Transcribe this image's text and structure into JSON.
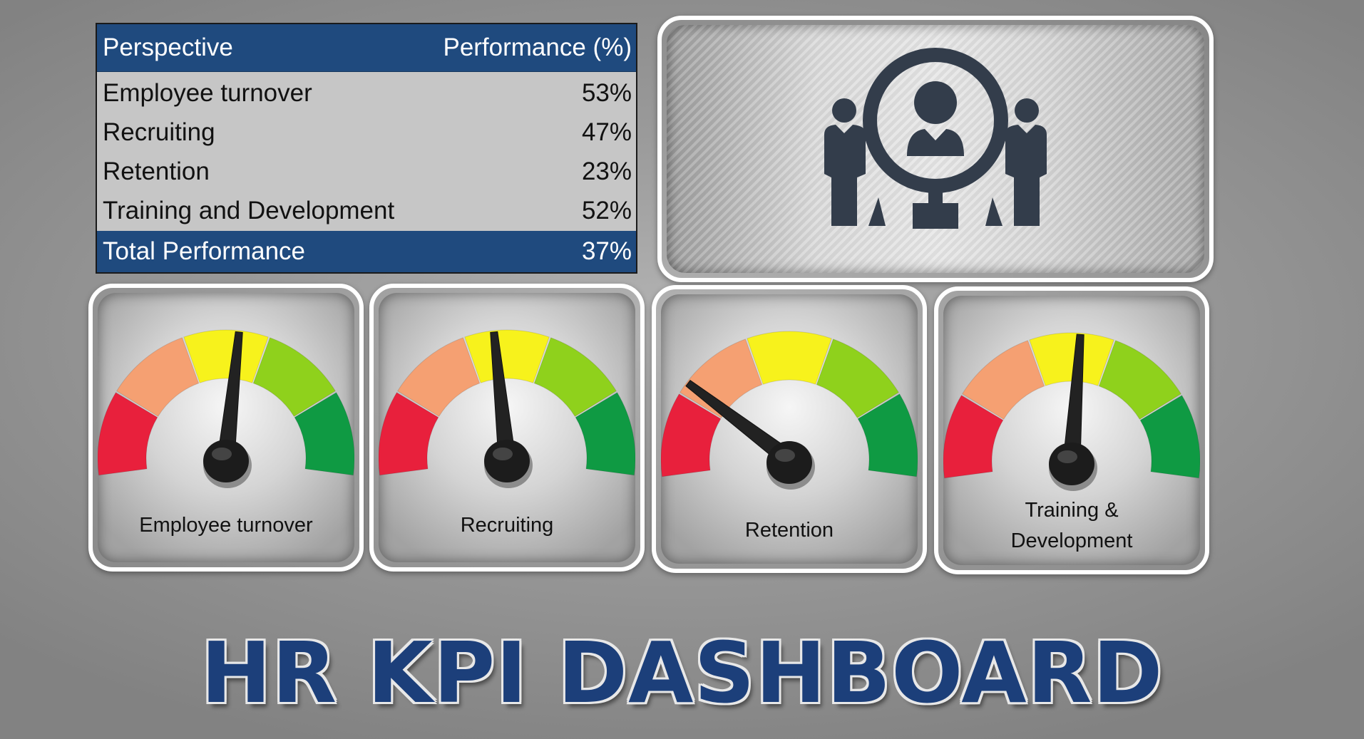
{
  "title": "HR KPI DASHBOARD",
  "icon": "hr-people-magnifier-icon",
  "table": {
    "header": {
      "perspective": "Perspective",
      "performance": "Performance (%)"
    },
    "rows": [
      {
        "perspective": "Employee turnover",
        "performance": "53%"
      },
      {
        "perspective": "Recruiting",
        "performance": "47%"
      },
      {
        "perspective": "Retention",
        "performance": "23%"
      },
      {
        "perspective": "Training and Development",
        "performance": "52%"
      }
    ],
    "total": {
      "perspective": "Total Performance",
      "performance": "37%"
    }
  },
  "gauges": [
    {
      "label": "Employee turnover",
      "value": 53
    },
    {
      "label": "Recruiting",
      "value": 47
    },
    {
      "label": "Retention",
      "value": 23
    },
    {
      "label": "Training & Development",
      "label_lines": [
        "Training &",
        "Development"
      ],
      "value": 52
    }
  ],
  "colors": {
    "table_header": "#1f4a7e",
    "title": "#1c3f7a",
    "zones": [
      "#e8203c",
      "#f5a072",
      "#f7f21c",
      "#8fd11c",
      "#0f9a43"
    ],
    "needle": "#222222",
    "icon": "#333d4b"
  },
  "chart_data": {
    "type": "gauge",
    "categories": [
      "Employee turnover",
      "Recruiting",
      "Retention",
      "Training & Development"
    ],
    "values": [
      53,
      47,
      23,
      52
    ],
    "ylim": [
      0,
      100
    ],
    "zones": [
      "red",
      "orange",
      "yellow",
      "light-green",
      "green"
    ],
    "title": "HR KPI DASHBOARD"
  }
}
